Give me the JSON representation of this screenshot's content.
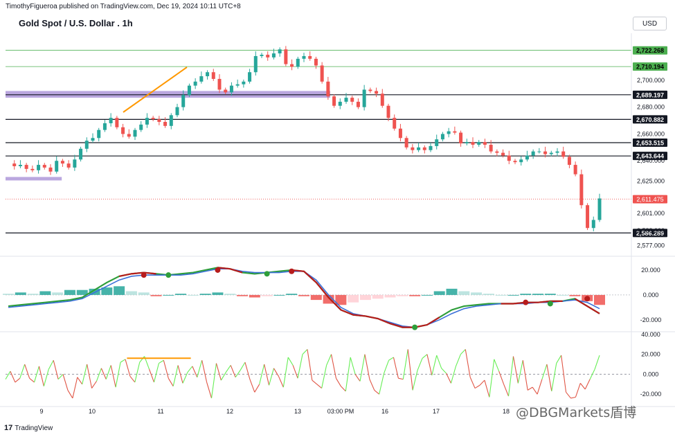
{
  "header": {
    "published_text": "TimothyFigueroa published on TradingView.com, Dec 19, 2024 10:11 UTC+8"
  },
  "title": "Gold Spot / U.S. Dollar . 1h",
  "currency_button": "USD",
  "footer": {
    "logo_text": "TradingView",
    "logo_icon": "tradingview-logo-icon"
  },
  "watermark": "@DBGMarkets盾博",
  "colors": {
    "up": "#26a69a",
    "down": "#ef5350",
    "fast_line": "#2e9e3a",
    "slow_line": "#3a6fd8",
    "signal_dark": "#b71c1c",
    "osc_up": "#66ee55",
    "osc_down": "#e05545",
    "zone": "#b39ddb",
    "trendline": "#ff9800",
    "level_green": "#4caf50"
  },
  "chart_data": [
    {
      "type": "candlestick",
      "title": "Gold Spot / U.S. Dollar . 1h",
      "x_tick_labels": [
        "9",
        "10",
        "11",
        "12",
        "13",
        "03:00 PM",
        "16",
        "17",
        "18"
      ],
      "y_tick_labels": [
        "2,700.000",
        "2,680.000",
        "2,660.000",
        "2,640.000",
        "2,625.000",
        "2,601.000",
        "2,588.000",
        "2,577.000"
      ],
      "ylim": [
        2570,
        2735
      ],
      "key_levels": [
        {
          "label": "2,722.268",
          "value": 2722.268,
          "style": "green"
        },
        {
          "label": "2,710.194",
          "value": 2710.194,
          "style": "green"
        },
        {
          "label": "2,689.197",
          "value": 2689.197,
          "style": "black"
        },
        {
          "label": "2,670.882",
          "value": 2670.882,
          "style": "black"
        },
        {
          "label": "2,653.515",
          "value": 2653.515,
          "style": "black"
        },
        {
          "label": "2,643.644",
          "value": 2643.644,
          "style": "black"
        },
        {
          "label": "2,586.289",
          "value": 2586.289,
          "style": "black"
        }
      ],
      "last_price": {
        "label": "2,611.475",
        "value": 2611.475
      },
      "close_path": [
        2638,
        2636,
        2637,
        2634,
        2633,
        2637,
        2635,
        2632,
        2640,
        2638,
        2635,
        2641,
        2649,
        2655,
        2657,
        2663,
        2668,
        2672,
        2665,
        2660,
        2658,
        2663,
        2667,
        2672,
        2671,
        2669,
        2666,
        2674,
        2680,
        2689,
        2696,
        2699,
        2703,
        2706,
        2701,
        2693,
        2691,
        2696,
        2697,
        2699,
        2706,
        2718,
        2719,
        2717,
        2720,
        2723,
        2712,
        2710,
        2716,
        2718,
        2716,
        2711,
        2699,
        2688,
        2681,
        2684,
        2687,
        2684,
        2680,
        2693,
        2692,
        2690,
        2681,
        2672,
        2664,
        2657,
        2650,
        2648,
        2650,
        2648,
        2651,
        2656,
        2660,
        2662,
        2661,
        2653,
        2654,
        2652,
        2654,
        2652,
        2647,
        2646,
        2644,
        2640,
        2639,
        2641,
        2644,
        2647,
        2647,
        2645,
        2646,
        2647,
        2643,
        2637,
        2630,
        2607,
        2590,
        2596,
        2612
      ],
      "zones": [
        {
          "from": 2692,
          "to": 2687,
          "start_pos": 0.0,
          "end_pos": 0.52
        },
        {
          "from": 2628,
          "to": 2626,
          "start_pos": 0.0,
          "end_pos": 0.09
        }
      ]
    },
    {
      "type": "line",
      "title": "",
      "y_tick_labels": [
        "20.000",
        "0.000",
        "-20.000"
      ],
      "ylim": [
        -29,
        30
      ],
      "series": [
        {
          "color": "#2e9e3a",
          "values": [
            -9,
            -8,
            -7,
            -6,
            -5,
            -4,
            -2,
            4,
            10,
            15,
            17,
            18,
            17,
            16,
            17,
            18,
            20,
            22,
            21,
            18,
            17,
            18,
            19,
            20,
            19,
            10,
            -2,
            -12,
            -16,
            -17,
            -19,
            -23,
            -26,
            -26,
            -24,
            -18,
            -12,
            -9,
            -8,
            -7,
            -7,
            -7,
            -6,
            -6,
            -5,
            -5,
            -3,
            -9,
            -15
          ]
        },
        {
          "color": "#3a6fd8",
          "values": [
            -10,
            -9,
            -8,
            -7,
            -6,
            -5,
            -3,
            2,
            7,
            12,
            15,
            16,
            16,
            16,
            16,
            17,
            19,
            21,
            21,
            19,
            18,
            18,
            18,
            19,
            19,
            12,
            0,
            -10,
            -15,
            -17,
            -19,
            -22,
            -25,
            -26,
            -24,
            -20,
            -15,
            -11,
            -9,
            -8,
            -7,
            -7,
            -7,
            -6,
            -6,
            -5,
            -4,
            -6,
            -11
          ]
        }
      ],
      "histogram": [
        1,
        2,
        1,
        3,
        2,
        4,
        4,
        5,
        6,
        7,
        3,
        2,
        -1,
        0,
        1,
        0,
        1,
        2,
        1,
        -1,
        -2,
        -1,
        0,
        1,
        -1,
        -4,
        -7,
        -8,
        -6,
        -4,
        -3,
        -2,
        -1,
        -1,
        0,
        3,
        5,
        3,
        2,
        1,
        0,
        0,
        1,
        1,
        1,
        0,
        -1,
        -5,
        -8
      ],
      "signal_dots": [
        {
          "value": 16,
          "color": "#b71c1c"
        },
        {
          "value": 16,
          "color": "#2e9e3a"
        },
        {
          "value": 20,
          "color": "#b71c1c"
        },
        {
          "value": 17,
          "color": "#2e9e3a"
        },
        {
          "value": 19,
          "color": "#b71c1c"
        },
        {
          "value": -26,
          "color": "#2e9e3a"
        },
        {
          "value": -6,
          "color": "#b71c1c"
        },
        {
          "value": -7,
          "color": "#2e9e3a"
        },
        {
          "value": -3,
          "color": "#b71c1c"
        }
      ]
    },
    {
      "type": "line",
      "title": "",
      "y_tick_labels": [
        "40.000",
        "20.000",
        "0.000",
        "-20.000"
      ],
      "ylim": [
        -31,
        42
      ],
      "dashed_zero": true,
      "series": [
        {
          "values": [
            -5,
            3,
            -8,
            -4,
            10,
            -4,
            -8,
            8,
            -12,
            5,
            14,
            -5,
            0,
            -16,
            -24,
            -3,
            -10,
            10,
            -14,
            -7,
            6,
            -5,
            9,
            -13,
            12,
            15,
            -2,
            -8,
            12,
            18,
            5,
            -8,
            11,
            14,
            -4,
            -12,
            9,
            -9,
            2,
            8,
            -3,
            14,
            -8,
            -24,
            11,
            -6,
            2,
            9,
            -3,
            4,
            12,
            -5,
            -18,
            -10,
            10,
            -11,
            6,
            -2,
            -13,
            17,
            9,
            -4,
            20,
            25,
            -6,
            -10,
            -14,
            9,
            20,
            -4,
            -12,
            -17,
            17,
            0,
            -7,
            20,
            -5,
            -16,
            -20,
            1,
            14,
            17,
            -4,
            -5,
            25,
            -16,
            4,
            16,
            20,
            -1,
            19,
            6,
            1,
            -9,
            8,
            20,
            25,
            -3,
            -14,
            -11,
            -6,
            -23,
            15,
            3,
            -10,
            -22,
            18,
            -9,
            14,
            -16,
            -13,
            -20,
            -5,
            10,
            -17,
            11,
            19,
            -18,
            -24,
            -23,
            -9,
            -15,
            -5,
            5,
            19
          ]
        }
      ],
      "divergence_line": {
        "value": 14,
        "start_pos": 0.2,
        "end_pos": 0.31
      }
    }
  ]
}
